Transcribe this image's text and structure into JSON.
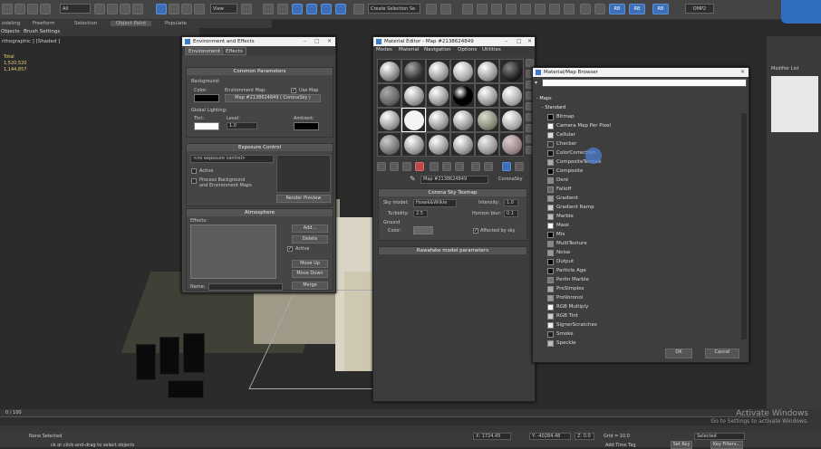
{
  "toolbar": {
    "filter_select": "All",
    "view_select": "View",
    "selection_set": "Create Selection Se",
    "badge_rb1": "RB",
    "badge_rb2": "RB",
    "badge_rb3": "RB",
    "omp_label": "OMP2"
  },
  "ribbon": {
    "tabs": [
      "odeling",
      "Freeform",
      "Selection",
      "Object Paint",
      "Populate"
    ],
    "sub": [
      "Objects",
      "Brush Settings"
    ]
  },
  "viewport": {
    "label": "rthographic ] [Shaded ]",
    "stats": [
      "Total",
      "1,520,520",
      "1,144,857"
    ]
  },
  "env_dialog": {
    "title": "Environment and Effects",
    "tabs": [
      "Environment",
      "Effects"
    ],
    "common": {
      "header": "Common Parameters",
      "background": "Background:",
      "color": "Color:",
      "env_map": "Environment Map:",
      "use_map": "Use Map",
      "map_btn": "Map #2138624849 ( CoronaSky )",
      "global": "Global Lighting:",
      "tint": "Tint:",
      "level": "Level:",
      "level_val": "1.0",
      "ambient": "Ambient:"
    },
    "exposure": {
      "header": "Exposure Control",
      "select": "<no exposure control>",
      "active": "Active",
      "process": "Process Background",
      "process2": "and Environment Maps",
      "render": "Render Preview"
    },
    "atmos": {
      "header": "Atmosphere",
      "effects": "Effects:",
      "add": "Add...",
      "delete": "Delete",
      "active": "Active",
      "up": "Move Up",
      "down": "Move Down",
      "name": "Name:",
      "merge": "Merge"
    }
  },
  "mat_editor": {
    "title": "Material Editor - Map #2138624849",
    "menu": [
      "Modes",
      "Material",
      "Navigation",
      "Options",
      "Utilities"
    ],
    "map_name": "Map #2138624849",
    "map_type": "CoronaSky",
    "tonemap": {
      "header": "Corona Sky Texmap",
      "sky_model": "Sky model:",
      "sky_val": "Hosek&Wilkie",
      "intensity": "Intensity:",
      "intensity_val": "1.0",
      "turbidity": "Turbidity:",
      "turbidity_val": "2.5",
      "horizon": "Horizon blur:",
      "horizon_val": "0.1",
      "ground": "Ground",
      "gcolor": "Color:",
      "affected": "Affected by sky"
    },
    "rawfake": "Rawafake model parameters"
  },
  "browser": {
    "title": "Material/Map Browser",
    "section": "Maps",
    "subsection": "Standard",
    "items": [
      "Bitmap",
      "Camera Map Per Pixel",
      "Cellular",
      "Checker",
      "ColorCorrection",
      "CompositeTexture",
      "Composite",
      "Dent",
      "Falloff",
      "Gradient",
      "Gradient Ramp",
      "Marble",
      "Mask",
      "Mix",
      "MultiTexture",
      "Noise",
      "Output",
      "Particle Age",
      "Perlin Marble",
      "ProSimplex",
      "ProVoronoi",
      "RGB Multiply",
      "RGB Tint",
      "SignerScratches",
      "Smoke",
      "Speckle"
    ],
    "ok": "OK",
    "cancel": "Cancel"
  },
  "cmd_panel": {
    "modifier_list": "Modifier List"
  },
  "timeline": {
    "frame": "0 / 100"
  },
  "status": {
    "selected": "None Selected",
    "hint": "ck or click-and-drag to select objects",
    "x": "X: 1724.45",
    "y": "Y: -40284.48",
    "z": "Z: 0.0",
    "grid": "Grid = 10.0",
    "set_key": "Set Key",
    "key_filters": "Key Filters...",
    "selected_mode": "Selected",
    "add_time_tag": "Add Time Tag"
  },
  "watermark": {
    "line1": "Activate Windows",
    "line2": "Go to Settings to activate Windows."
  }
}
